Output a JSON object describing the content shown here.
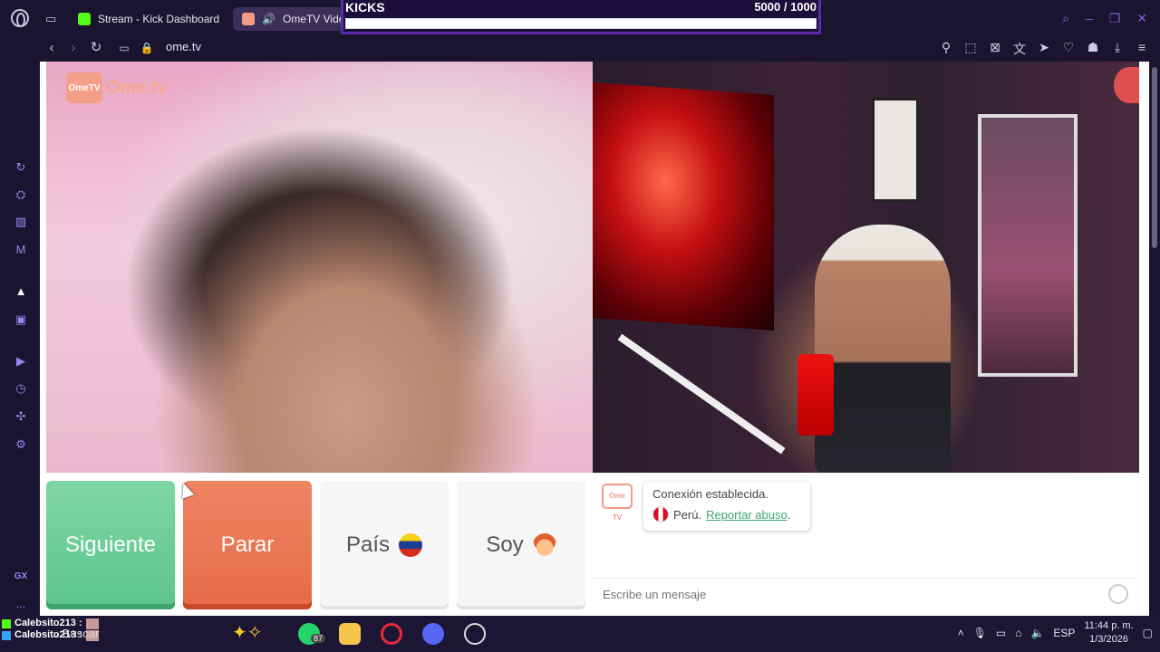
{
  "browser": {
    "tabs": [
      {
        "label": "Stream - Kick Dashboard",
        "icon": "kick-icon"
      },
      {
        "label": "OmeTV Video Chat",
        "icon": "ometv-icon"
      }
    ],
    "new_tab_symbol": "+",
    "url": "ome.tv"
  },
  "kicks_overlay": {
    "title": "KICKS",
    "count": "5000  / 1000",
    "progress": 1.0
  },
  "ome": {
    "logo_badge": "Ome\nTV",
    "logo_text": "Ome.tv",
    "buttons": {
      "next": "Siguiente",
      "stop": "Parar",
      "country": "País",
      "gender": "Soy"
    },
    "chat": {
      "logo_badge": "Ome TV",
      "status": "Conexión establecida.",
      "country": "Perú.",
      "report_link": "Reportar abuso",
      "report_suffix": ".",
      "input_placeholder": "Escribe un mensaje"
    }
  },
  "sidebar": {
    "items": [
      "refresh-icon",
      "crypto-wallet-icon",
      "aria-icon",
      "messenger-icon",
      "kick-icon",
      "twitch-icon",
      "player-icon",
      "history-icon",
      "extensions-icon",
      "settings-icon",
      "gx-icon",
      "more-icon"
    ],
    "gx_label": "GX",
    "more_label": "..."
  },
  "taskbar": {
    "users": [
      "Calebsito213 :",
      "Calebsito213 :"
    ],
    "search": "Buscar",
    "whatsapp_badge": "87",
    "language": "ESP",
    "time": "11:44 p. m.",
    "date": "1/3/2026"
  },
  "colors": {
    "browser_bg": "#1b1430",
    "accent": "#7c63d8",
    "next_button": "#5cc48b",
    "stop_button": "#e56a49",
    "report_link": "#3fa56d"
  }
}
